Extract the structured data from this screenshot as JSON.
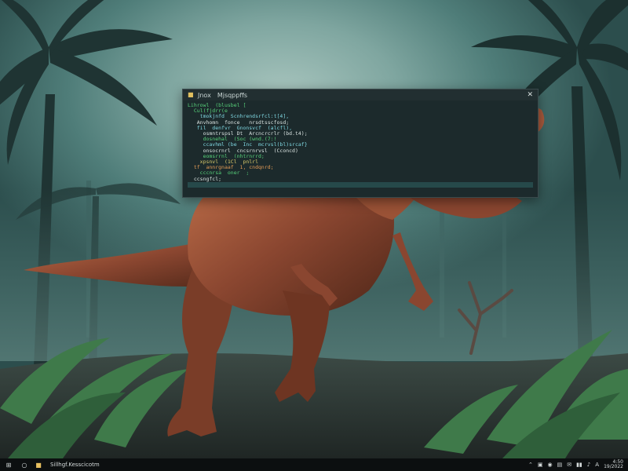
{
  "colors": {
    "code_green": "#57d07a",
    "code_cyan": "#7fd6e0",
    "code_white": "#d8e2e0",
    "code_yellow": "#d9c96a",
    "code_orange": "#e09a55"
  },
  "window": {
    "title_menu_1": "Jnox",
    "title_menu_2": "Mjsqppffs",
    "close_glyph": "✕",
    "code_lines": [
      {
        "text": "Lihrowl  (blusbel [",
        "color": "code_green"
      },
      {
        "text": "  Cul(fjdrr(e",
        "color": "code_green"
      },
      {
        "text": "    tmokjnfd  Scnhrendsrfcl:t[4],",
        "color": "code_cyan"
      },
      {
        "text": "   Anvhomn  fonce   nrsdtsscfosd;",
        "color": "code_white"
      },
      {
        "text": "   fil  denfvr  Gnonsvcf  (alcfl),",
        "color": "code_cyan"
      },
      {
        "text": "     osmntrspsl Dt  Arcncrcrlr (bd.t4);",
        "color": "code_white"
      },
      {
        "text": "     dosnehal  (Soc (wnd.(7:!",
        "color": "code_green"
      },
      {
        "text": "     ccavhml (be  Inc  mcrvsl(bl)srcaf}",
        "color": "code_cyan"
      },
      {
        "text": "     onsocrnrl  cncsrnrvsl  (Cconcd)",
        "color": "code_white"
      },
      {
        "text": "     eomsrrnl  (nhtrnrrd;",
        "color": "code_green"
      },
      {
        "text": "    xpsnvl  (1Cl  pnlrl",
        "color": "code_yellow"
      },
      {
        "text": "  tf  annrgnaaf  1, cndqnrd;",
        "color": "code_orange"
      },
      {
        "text": "    cccnrsa  oner  ;",
        "color": "code_green"
      },
      {
        "text": "  ccsngfcl;",
        "color": "code_white"
      },
      {
        "text": "",
        "color": "code_white"
      }
    ]
  },
  "taskbar": {
    "start_glyph": "⊞",
    "search_glyph": "○",
    "app_glyph": "■",
    "label": "Sillhgf.Kesscicotm",
    "tray": [
      "⌃",
      "▣",
      "◉",
      "▤",
      "✉",
      "▮▮",
      "♪",
      "A"
    ],
    "clock_time": "4:50",
    "clock_date": "19/2022"
  }
}
